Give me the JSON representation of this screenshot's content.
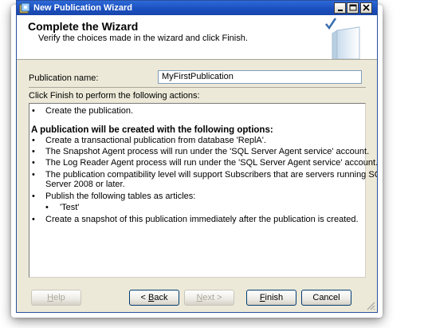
{
  "window": {
    "title": "New Publication Wizard",
    "colors": {
      "titlebar": "#1b4fbf",
      "face": "#ece9d8",
      "header_bg": "#ffffff"
    }
  },
  "header": {
    "title": "Complete the Wizard",
    "subtitle": "Verify the choices made in the wizard and click Finish."
  },
  "form": {
    "publication_name_label": "Publication name:",
    "publication_name_value": "MyFirstPublication"
  },
  "instructions": "Click Finish to perform the following actions:",
  "actions": {
    "items": [
      {
        "text": "Create the publication."
      },
      {
        "text": "A publication will be created with the following options:"
      },
      {
        "text": "Create a transactional publication from database 'ReplA'."
      },
      {
        "text": "The Snapshot Agent process will run under the 'SQL Server Agent service' account."
      },
      {
        "text": "The Log Reader Agent process will run under the 'SQL Server Agent service' account."
      },
      {
        "text": "The publication compatibility level will support Subscribers that are servers running SQL"
      },
      {
        "text": "Server 2008 or later."
      },
      {
        "text": "Publish the following tables as articles:"
      },
      {
        "text": "'Test'"
      },
      {
        "text": "Create a snapshot of this publication immediately after the publication is created."
      }
    ]
  },
  "buttons": {
    "help": {
      "label": "Help",
      "enabled": false
    },
    "back": {
      "label": "< Back",
      "enabled": true
    },
    "next": {
      "label": "Next >",
      "enabled": false
    },
    "finish": {
      "label": "Finish",
      "enabled": true
    },
    "cancel": {
      "label": "Cancel",
      "enabled": true
    }
  },
  "icons": {
    "app": "wizard-icon",
    "minimize": "minimize-icon",
    "maximize": "maximize-icon",
    "close": "close-icon",
    "header_graphic": "book-checkmark-icon",
    "resize": "resize-grip-icon"
  }
}
